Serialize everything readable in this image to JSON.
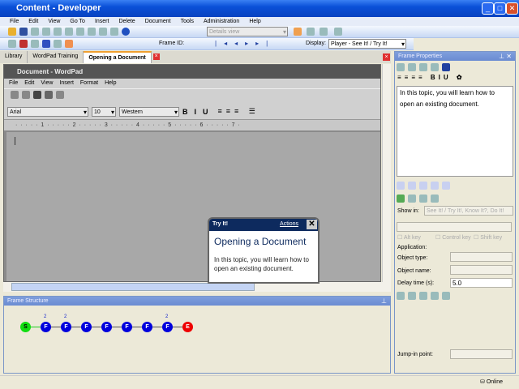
{
  "window": {
    "title": "Content - Developer"
  },
  "menu": [
    "File",
    "Edit",
    "View",
    "Go To",
    "Insert",
    "Delete",
    "Document",
    "Tools",
    "Administration",
    "Help"
  ],
  "toolbar": {
    "view_select": "Details view",
    "frame_id_label": "Frame ID:",
    "display_label": "Display:",
    "display_value": "Player - See It! / Try It!"
  },
  "tabs": [
    {
      "label": "Library"
    },
    {
      "label": "WordPad Training"
    },
    {
      "label": "Opening a Document"
    }
  ],
  "wordpad": {
    "title": "Document - WordPad",
    "menu": [
      "File",
      "Edit",
      "View",
      "Insert",
      "Format",
      "Help"
    ],
    "font": "Arial",
    "size": "10",
    "script": "Western",
    "ruler": "· · · · · 1 · · · · · 2 · · · · · 3 · · · · · 4 · · · · · 5 · · · · · 6 · · · · · 7 ·"
  },
  "tryit": {
    "mode": "Try It!",
    "actions": "Actions",
    "title": "Opening a Document",
    "body": "In this topic, you will learn how to open an existing document."
  },
  "frame_structure": {
    "title": "Frame Structure",
    "nodes": [
      "S",
      "F",
      "F",
      "F",
      "F",
      "F",
      "F",
      "F",
      "E"
    ],
    "counts": [
      "2",
      "2",
      "2"
    ]
  },
  "frame_properties": {
    "title": "Frame Properties",
    "text": "In this topic, you will learn how to open an existing document.",
    "show_in_label": "Show in:",
    "show_in_value": "See It! / Try It!, Know It?, Do It!",
    "alt_key": "Alt key",
    "control_key": "Control key",
    "shift_key": "Shift key",
    "application_label": "Application:",
    "object_type_label": "Object type:",
    "object_name_label": "Object name:",
    "delay_label": "Delay time (s):",
    "delay_value": "5.0",
    "jump_in_label": "Jump-in point:"
  },
  "status": {
    "online": "Online"
  }
}
